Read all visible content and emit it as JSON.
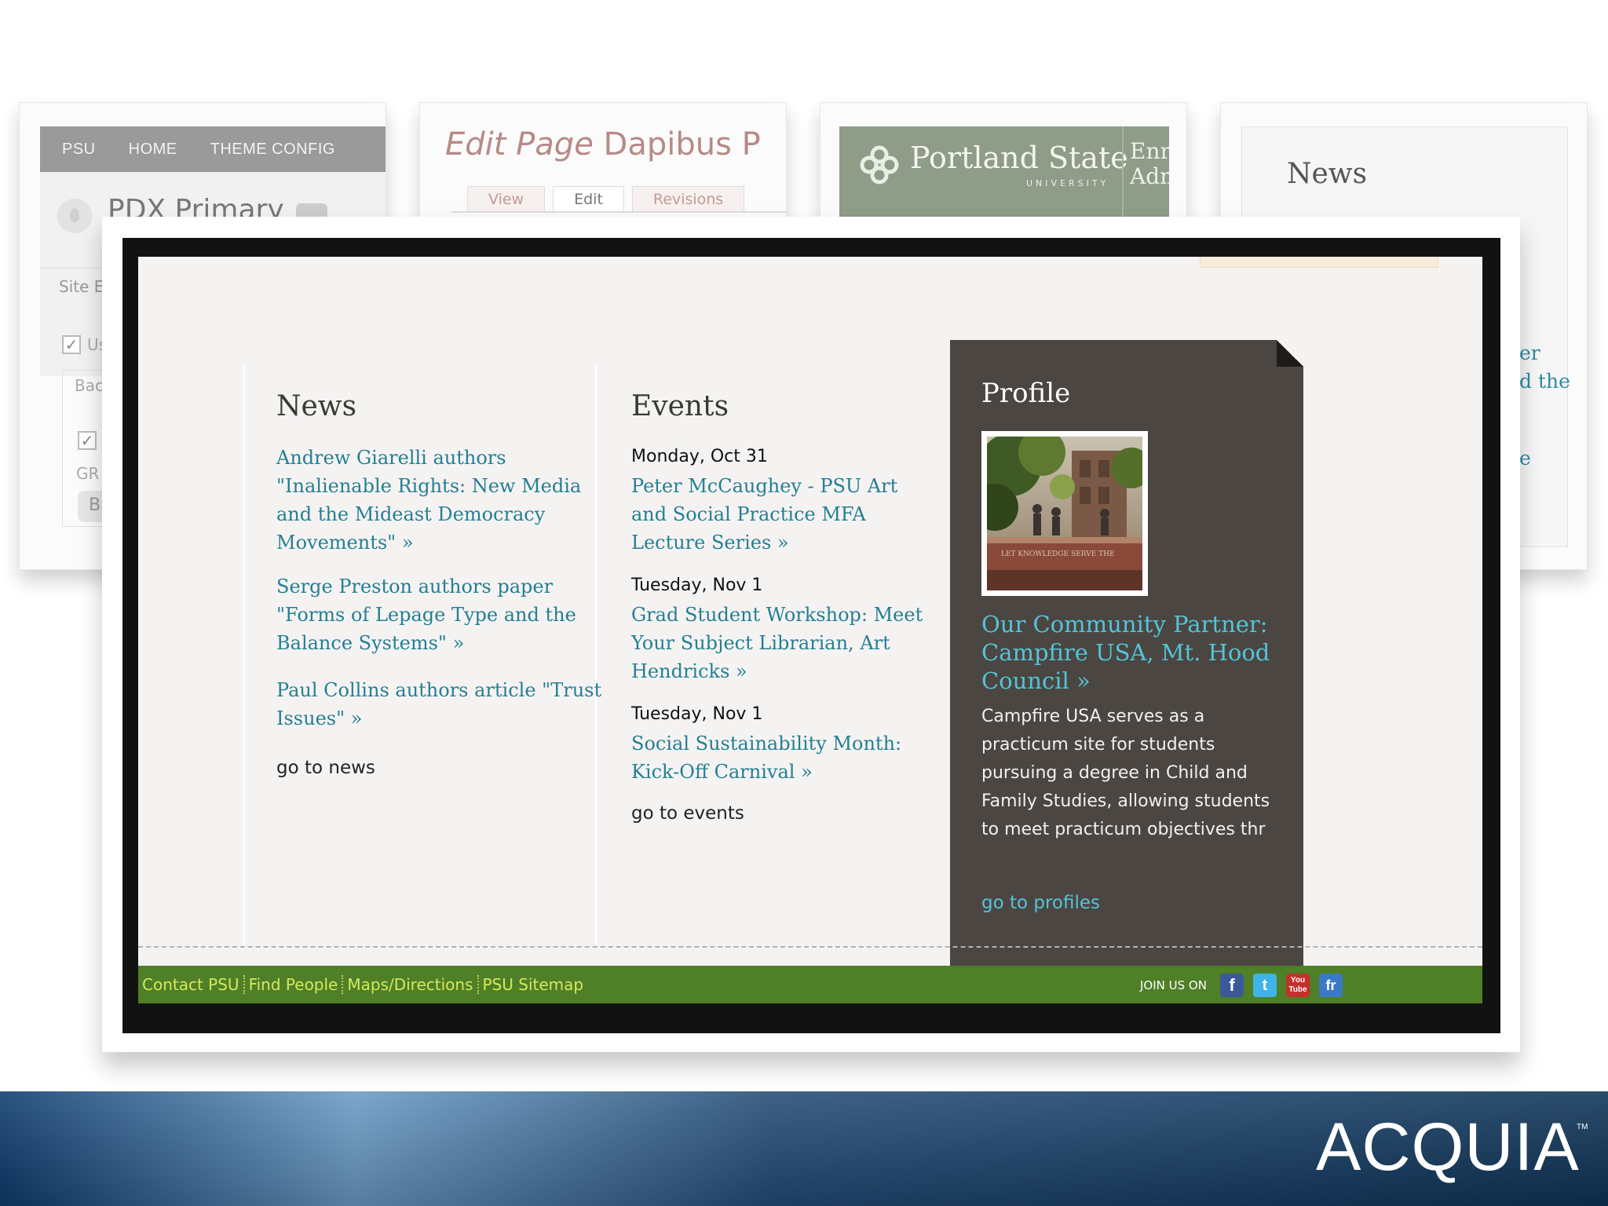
{
  "thumbnails": {
    "admin": {
      "nav": [
        "PSU",
        "HOME",
        "THEME CONFIG"
      ],
      "title": "PDX Primary",
      "site_label": "Site E",
      "checkbox_label": "Us",
      "bac_label": "Bac",
      "gr_label": "GR",
      "button_letter": "B"
    },
    "edit_page": {
      "title_italic": "Edit Page",
      "title_rest": "Dapibus P",
      "tabs": [
        "View",
        "Edit",
        "Revisions"
      ],
      "active_tab": "Edit"
    },
    "portland": {
      "name": "Portland State",
      "university": "UNIVERSITY",
      "side_lines": [
        "Enro",
        "Adm"
      ]
    },
    "news": {
      "heading": "News",
      "fragments": [
        "er",
        "d the",
        "e"
      ]
    }
  },
  "news": {
    "heading": "News",
    "items": [
      "Andrew Giarelli authors \"Inalienable Rights: New Media and the Mideast Democracy Movements\" »",
      "Serge Preston authors paper \"Forms of Lepage Type and the Balance Systems\" »",
      "Paul Collins authors article \"Trust Issues\" »"
    ],
    "more": "go to news"
  },
  "events": {
    "heading": "Events",
    "items": [
      {
        "date": "Monday, Oct 31",
        "title": "Peter McCaughey - PSU Art and Social Practice MFA Lecture Series »"
      },
      {
        "date": "Tuesday, Nov 1",
        "title": "Grad Student Workshop: Meet Your Subject Librarian, Art Hendricks »"
      },
      {
        "date": "Tuesday, Nov 1",
        "title": "Social Sustainability Month: Kick-Off Carnival »"
      }
    ],
    "more": "go to events"
  },
  "profile": {
    "heading": "Profile",
    "photo_caption": "LET KNOWLEDGE SERVE THE",
    "title": "Our Community Partner: Campfire USA, Mt. Hood Council »",
    "description": "Campfire USA serves as a practicum site for students pursuing a degree in Child and Family Studies, allowing students to meet practicum objectives thr",
    "more": "go to profiles"
  },
  "footer": {
    "links": [
      "Contact PSU",
      "Find People",
      "Maps/Directions",
      "PSU Sitemap"
    ],
    "join_label": "JOIN US ON",
    "social": {
      "facebook": "f",
      "twitter": "t",
      "youtube_top": "You",
      "youtube_bottom": "Tube",
      "flickr": "fr"
    }
  },
  "brand": {
    "name": "ACQUIA",
    "tm": "TM"
  },
  "colors": {
    "link": "#237f94",
    "profile_link": "#53c4d9",
    "footer_bg": "#4f7f27",
    "footer_text": "#d5e85a",
    "profile_bg": "#4b4641"
  }
}
